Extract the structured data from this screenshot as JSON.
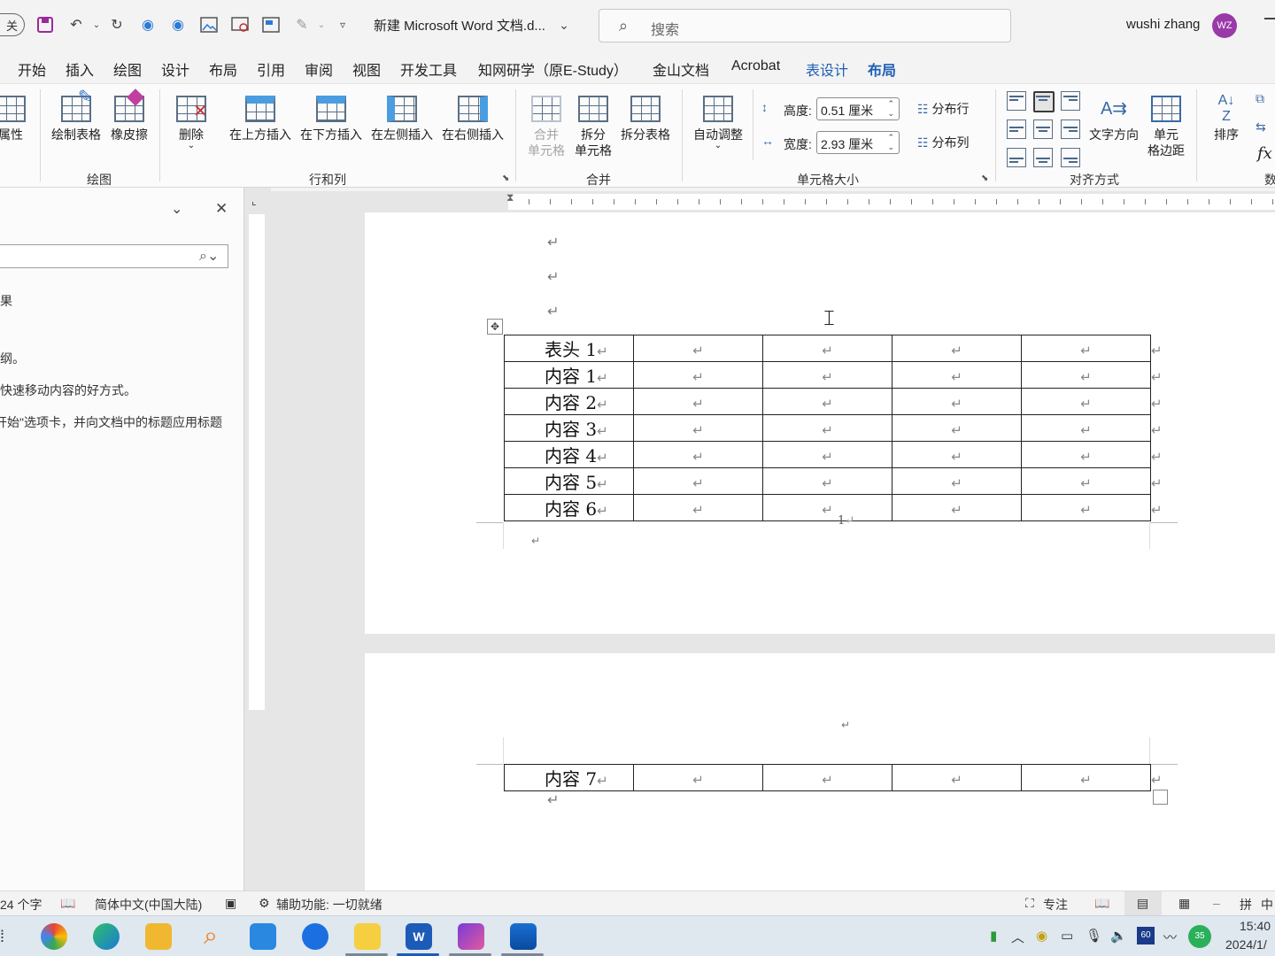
{
  "titlebar": {
    "autosave_label": "关",
    "doc_title": "新建 Microsoft Word 文档.d...",
    "search_placeholder": "搜索",
    "user_name": "wushi zhang",
    "avatar_initials": "WZ"
  },
  "tabs": [
    "开始",
    "插入",
    "绘图",
    "设计",
    "布局",
    "引用",
    "审阅",
    "视图",
    "开发工具",
    "知网研学（原E-Study）",
    "金山文档",
    "Acrobat",
    "表设计",
    "布局"
  ],
  "ribbon": {
    "properties": "属性",
    "draw_table": "绘制表格",
    "eraser": "橡皮擦",
    "delete": "删除",
    "insert_above": "在上方插入",
    "insert_below": "在下方插入",
    "insert_left": "在左侧插入",
    "insert_right": "在右侧插入",
    "merge_cells_1": "合并",
    "merge_cells_2": "单元格",
    "split_cells_1": "拆分",
    "split_cells_2": "单元格",
    "split_table": "拆分表格",
    "autofit": "自动调整",
    "height_label": "高度:",
    "height_value": "0.51 厘米",
    "width_label": "宽度:",
    "width_value": "2.93 厘米",
    "distribute_rows": "分布行",
    "distribute_cols": "分布列",
    "text_direction": "文字方向",
    "cell_margins_1": "单元",
    "cell_margins_2": "格边距",
    "sort": "排序",
    "formula": "fx",
    "data_partial": "数",
    "groups": {
      "draw": "绘图",
      "rows_cols": "行和列",
      "merge": "合并",
      "cell_size": "单元格大小",
      "alignment": "对齐方式"
    }
  },
  "navpane": {
    "line1": "果",
    "line2": "纲。",
    "line3": "快速移动内容的好方式。",
    "line4": "开始\"选项卡，并向文档中的标题应用标题"
  },
  "document": {
    "table_rows": [
      "表头 1",
      "内容 1",
      "内容 2",
      "内容 3",
      "内容 4",
      "内容 5",
      "内容 6"
    ],
    "page_number": "1",
    "page2_rows": [
      "内容 7"
    ],
    "para_mark": "↵"
  },
  "statusbar": {
    "word_count": "24 个字",
    "language": "简体中文(中国大陆)",
    "accessibility": "辅助功能: 一切就绪",
    "focus": "专注",
    "ime": "中"
  },
  "taskbar": {
    "time": "15:40",
    "date": "2024/1/",
    "badge_60": "60",
    "badge_35": "35"
  }
}
